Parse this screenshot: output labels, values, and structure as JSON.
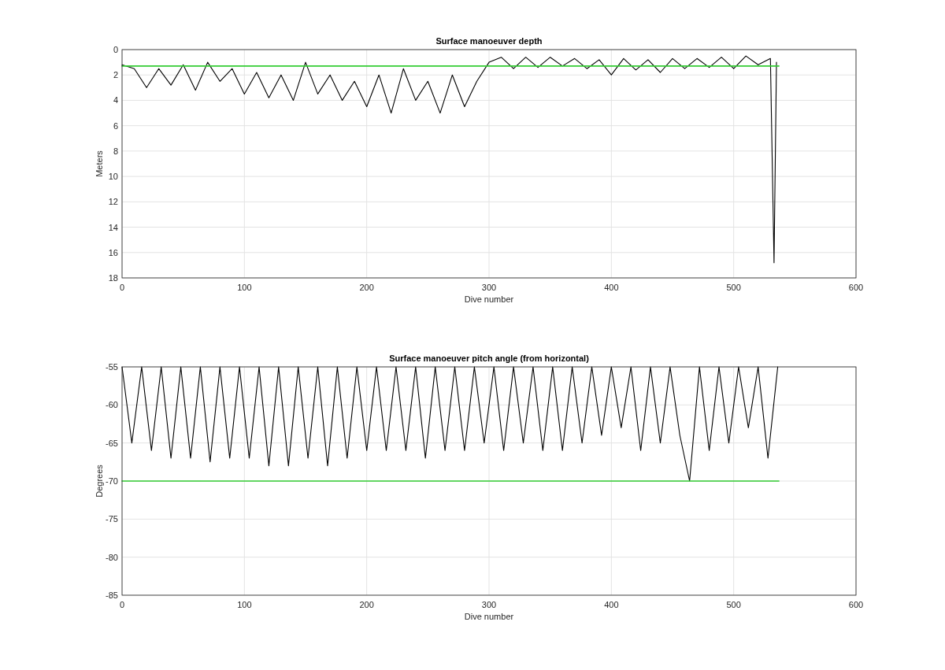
{
  "charts": [
    {
      "chart_data": {
        "type": "line",
        "title": "Surface manoeuver depth",
        "xlabel": "Dive number",
        "ylabel": "Meters",
        "xlim": [
          0,
          600
        ],
        "ylim": [
          18,
          0
        ],
        "xticks": [
          0,
          100,
          200,
          300,
          400,
          500,
          600
        ],
        "yticks": [
          0,
          2,
          4,
          6,
          8,
          10,
          12,
          14,
          16,
          18
        ],
        "series": [
          {
            "color": "#000000",
            "x": [
              0,
              10,
              20,
              30,
              40,
              50,
              60,
              70,
              80,
              90,
              100,
              110,
              120,
              130,
              140,
              150,
              160,
              170,
              180,
              190,
              200,
              210,
              220,
              230,
              240,
              250,
              260,
              270,
              280,
              290,
              300,
              310,
              320,
              330,
              340,
              350,
              360,
              370,
              380,
              390,
              400,
              410,
              420,
              430,
              440,
              450,
              460,
              470,
              480,
              490,
              500,
              510,
              520,
              530,
              533,
              535
            ],
            "values": [
              1.2,
              1.5,
              3.0,
              1.5,
              2.8,
              1.2,
              3.2,
              1.0,
              2.5,
              1.5,
              3.5,
              1.8,
              3.8,
              2.0,
              4.0,
              1.0,
              3.5,
              2.0,
              4.0,
              2.5,
              4.5,
              2.0,
              5.0,
              1.5,
              4.0,
              2.5,
              5.0,
              2.0,
              4.5,
              2.5,
              1.0,
              0.6,
              1.5,
              0.6,
              1.4,
              0.6,
              1.3,
              0.7,
              1.5,
              0.8,
              2.0,
              0.7,
              1.6,
              0.8,
              1.8,
              0.7,
              1.5,
              0.7,
              1.4,
              0.6,
              1.5,
              0.5,
              1.2,
              0.7,
              16.8,
              1.0
            ]
          },
          {
            "color": "#33cc33",
            "x": [
              0,
              537
            ],
            "values": [
              1.3,
              1.3
            ]
          }
        ],
        "grid": true
      }
    },
    {
      "chart_data": {
        "type": "line",
        "title": "Surface manoeuver pitch angle (from horizontal)",
        "xlabel": "Dive number",
        "ylabel": "Degrees",
        "xlim": [
          0,
          600
        ],
        "ylim": [
          -85,
          -55
        ],
        "xticks": [
          0,
          100,
          200,
          300,
          400,
          500,
          600
        ],
        "yticks": [
          -55,
          -60,
          -65,
          -70,
          -75,
          -80,
          -85
        ],
        "series": [
          {
            "color": "#000000",
            "x": [
              0,
              8,
              16,
              24,
              32,
              40,
              48,
              56,
              64,
              72,
              80,
              88,
              96,
              104,
              112,
              120,
              128,
              136,
              144,
              152,
              160,
              168,
              176,
              184,
              192,
              200,
              208,
              216,
              224,
              232,
              240,
              248,
              256,
              264,
              272,
              280,
              288,
              296,
              304,
              312,
              320,
              328,
              336,
              344,
              352,
              360,
              368,
              376,
              384,
              392,
              400,
              408,
              416,
              424,
              432,
              440,
              448,
              456,
              464,
              472,
              480,
              488,
              496,
              504,
              512,
              520,
              528,
              536
            ],
            "values": [
              -55,
              -65,
              -55,
              -66,
              -55,
              -67,
              -55,
              -67,
              -55,
              -67.5,
              -55,
              -67,
              -55,
              -67,
              -55,
              -68,
              -55,
              -68,
              -55,
              -67,
              -55,
              -68,
              -55,
              -67,
              -55,
              -66,
              -55,
              -66,
              -55,
              -66,
              -55,
              -67,
              -55,
              -66,
              -55,
              -66,
              -55,
              -65,
              -55,
              -66,
              -55,
              -65,
              -55,
              -66,
              -55,
              -66,
              -55,
              -65,
              -55,
              -64,
              -55,
              -63,
              -55,
              -66,
              -55,
              -65,
              -55,
              -64,
              -70,
              -55,
              -66,
              -55,
              -65,
              -55,
              -63,
              -55,
              -67,
              -55
            ]
          },
          {
            "color": "#33cc33",
            "x": [
              0,
              537
            ],
            "values": [
              -70,
              -70
            ]
          }
        ],
        "grid": true
      }
    }
  ]
}
